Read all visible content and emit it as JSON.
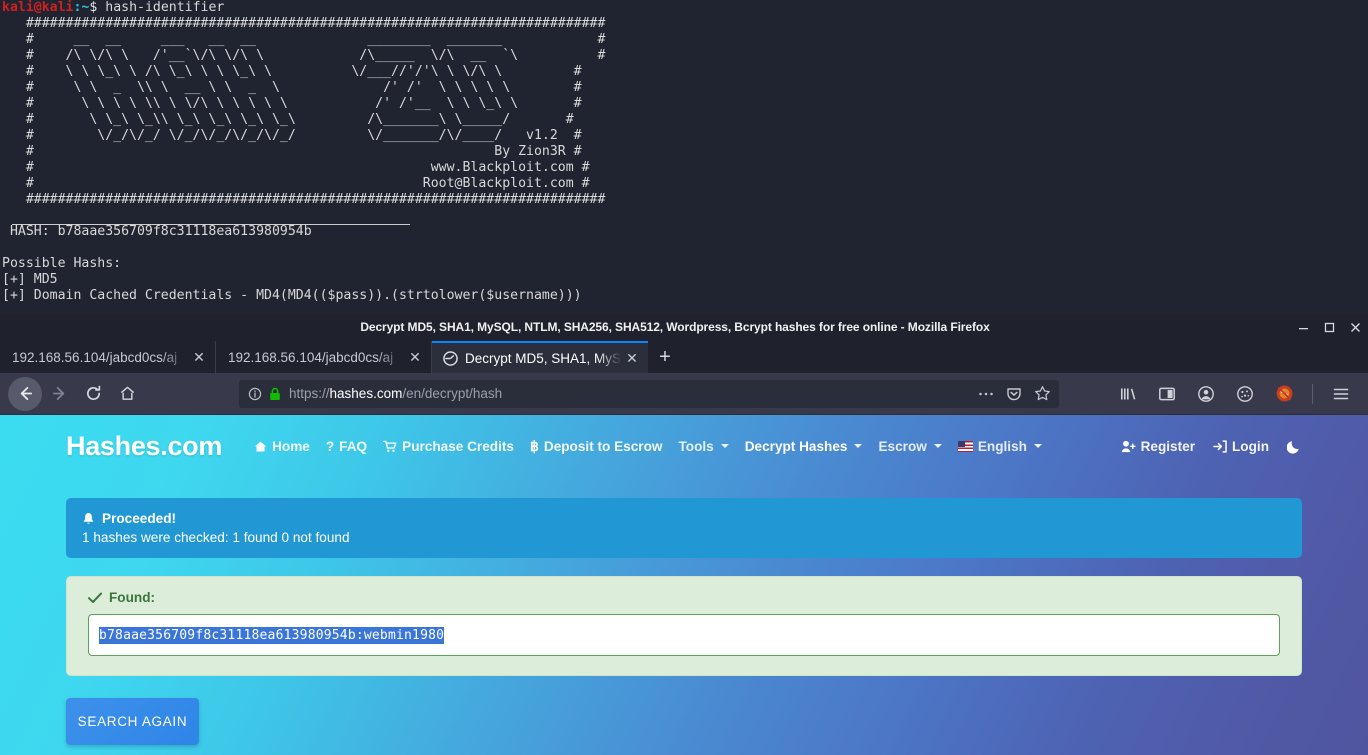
{
  "terminal": {
    "prompt_user": "kali@kali",
    "prompt_path": ":~",
    "prompt_symbol": "$ ",
    "command": "hash-identifier",
    "banner": "   #########################################################################\n   #     __  __     ___   __  __              ________  _______            #\n   #    /\\ \\/\\ \\   /'__`\\/\\ \\/\\ \\            /\\_____  \\/\\  __  `\\          #\n   #    \\ \\ \\_\\ \\ /\\ \\_\\ \\ \\ \\_\\ \\          \\/___//'/'\\ \\ \\/\\ \\         #\n   #     \\ \\  _  \\\\ \\  __ \\ \\  _  \\             /' /'  \\ \\ \\ \\ \\        #\n   #      \\ \\ \\ \\ \\\\ \\ \\/\\ \\ \\ \\ \\ \\           /' /'__  \\ \\ \\_\\ \\       #\n   #       \\ \\_\\ \\_\\\\ \\_\\ \\_\\ \\_\\ \\_\\         /\\_______\\ \\_____/       #\n   #        \\/_/\\/_/ \\/_/\\/_/\\/_/\\/_/         \\/_______/\\/____/   v1.2  #\n   #                                                          By Zion3R #\n   #                                                  www.Blackploit.com #\n   #                                                 Root@Blackploit.com #\n   #########################################################################",
    "hash_line": " HASH: b78aae356709f8c31118ea613980954b",
    "possible_header": "Possible Hashs:",
    "possible_1": "[+] MD5",
    "possible_2": "[+] Domain Cached Credentials - MD4(MD4(($pass)).(strtolower($username)))"
  },
  "browser": {
    "window_title": "Decrypt MD5, SHA1, MySQL, NTLM, SHA256, SHA512, Wordpress, Bcrypt hashes for free online - Mozilla Firefox",
    "minimize_label": "–",
    "maximize_label": "▫",
    "close_label": "✕",
    "tabs": [
      {
        "label": "192.168.56.104/jabcd0cs/aj",
        "active": false
      },
      {
        "label": "192.168.56.104/jabcd0cs/aj",
        "active": false
      },
      {
        "label": "Decrypt MD5, SHA1, MyS",
        "active": true
      }
    ],
    "new_tab_label": "+",
    "url_prefix": "https://",
    "url_host": "hashes.com",
    "url_path": "/en/decrypt/hash",
    "close_glyph": "✕"
  },
  "site": {
    "brand": "Hashes.com",
    "nav": [
      {
        "label": "Home",
        "icon": "home-icon",
        "caret": false
      },
      {
        "label": "FAQ",
        "icon": "question-icon",
        "caret": false
      },
      {
        "label": "Purchase Credits",
        "icon": "cart-icon",
        "caret": false
      },
      {
        "label": "Deposit to Escrow",
        "icon": "bitcoin-icon",
        "caret": false
      },
      {
        "label": "Tools",
        "icon": "",
        "caret": true
      },
      {
        "label": "Decrypt Hashes",
        "icon": "",
        "caret": true
      },
      {
        "label": "Escrow",
        "icon": "",
        "caret": true
      },
      {
        "label": "English",
        "icon": "flag-us-icon",
        "caret": true
      }
    ],
    "register_label": "Register",
    "login_label": "Login",
    "dark_mode_icon": "moon-icon"
  },
  "main": {
    "alert_info_title": "Proceeded!",
    "alert_info_body": "1 hashes were checked: 1 found 0 not found",
    "found_title": "Found:",
    "found_value": "b78aae356709f8c31118ea613980954b:webmin1980",
    "search_again_label": "SEARCH AGAIN"
  },
  "colors": {
    "accent_cyan": "#3bdcf0",
    "accent_purple": "#50559f",
    "alert_info_bg": "#2197d4",
    "alert_success_bg": "#dcedda",
    "success_text": "#3c763d",
    "selection_blue": "#3a75d8",
    "tab_active_border": "#0a84ff",
    "terminal_bg": "#1f2430",
    "prompt_red": "#d02020"
  }
}
